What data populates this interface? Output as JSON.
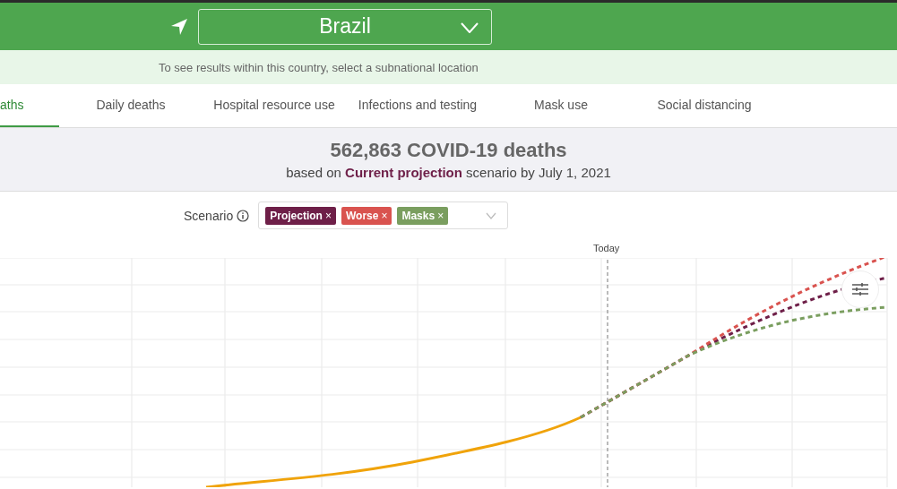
{
  "location": {
    "value": "Brazil"
  },
  "subnational_hint": "To see results within this country, select a subnational location",
  "tabs": [
    {
      "label": "aths",
      "selected": true
    },
    {
      "label": "Daily deaths",
      "selected": false
    },
    {
      "label": "Hospital resource use",
      "selected": false
    },
    {
      "label": "Infections and testing",
      "selected": false
    },
    {
      "label": "Mask use",
      "selected": false
    },
    {
      "label": "Social distancing",
      "selected": false
    }
  ],
  "summary": {
    "headline": "562,863 COVID-19 deaths",
    "subtitle": "based on **Current projection** scenario by July 1, 2021"
  },
  "scenario": {
    "label": "Scenario",
    "chips": [
      {
        "label": "Projection",
        "remove": "×",
        "color": "#6e1f48"
      },
      {
        "label": "Worse",
        "remove": "×",
        "color": "#d9534f"
      },
      {
        "label": "Masks",
        "remove": "×",
        "color": "#7a9e5f"
      }
    ]
  },
  "chart": {
    "today_label": "Today"
  }
}
